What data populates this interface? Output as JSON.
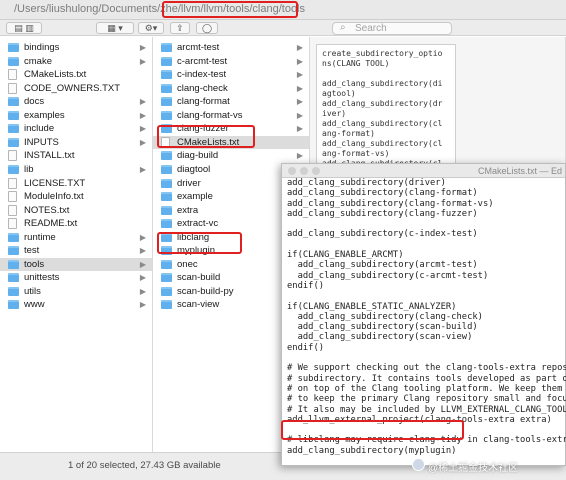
{
  "finder": {
    "path": "/Users/liushulong/Documents/zhe/llvm/llvm/tools/clang/tools",
    "search_placeholder": "Search",
    "status": "1 of 20 selected, 27.43 GB available",
    "column1": [
      {
        "label": "bindings",
        "kind": "folder"
      },
      {
        "label": "cmake",
        "kind": "folder"
      },
      {
        "label": "CMakeLists.txt",
        "kind": "file"
      },
      {
        "label": "CODE_OWNERS.TXT",
        "kind": "file"
      },
      {
        "label": "docs",
        "kind": "folder"
      },
      {
        "label": "examples",
        "kind": "folder"
      },
      {
        "label": "include",
        "kind": "folder"
      },
      {
        "label": "INPUTS",
        "kind": "folder"
      },
      {
        "label": "INSTALL.txt",
        "kind": "file"
      },
      {
        "label": "lib",
        "kind": "folder"
      },
      {
        "label": "LICENSE.TXT",
        "kind": "file"
      },
      {
        "label": "ModuleInfo.txt",
        "kind": "file"
      },
      {
        "label": "NOTES.txt",
        "kind": "file"
      },
      {
        "label": "README.txt",
        "kind": "file"
      },
      {
        "label": "runtime",
        "kind": "folder"
      },
      {
        "label": "test",
        "kind": "folder"
      },
      {
        "label": "tools",
        "kind": "folder",
        "selected": true
      },
      {
        "label": "unittests",
        "kind": "folder"
      },
      {
        "label": "utils",
        "kind": "folder"
      },
      {
        "label": "www",
        "kind": "folder"
      }
    ],
    "column2": [
      {
        "label": "arcmt-test",
        "kind": "folder"
      },
      {
        "label": "c-arcmt-test",
        "kind": "folder"
      },
      {
        "label": "c-index-test",
        "kind": "folder"
      },
      {
        "label": "clang-check",
        "kind": "folder"
      },
      {
        "label": "clang-format",
        "kind": "folder"
      },
      {
        "label": "clang-format-vs",
        "kind": "folder"
      },
      {
        "label": "clang-fuzzer",
        "kind": "folder"
      },
      {
        "label": "CMakeLists.txt",
        "kind": "file",
        "selected": true
      },
      {
        "label": "diag-build",
        "kind": "folder"
      },
      {
        "label": "diagtool",
        "kind": "folder"
      },
      {
        "label": "driver",
        "kind": "folder"
      },
      {
        "label": "example",
        "kind": "folder"
      },
      {
        "label": "extra",
        "kind": "folder"
      },
      {
        "label": "extract-vc",
        "kind": "folder"
      },
      {
        "label": "libclang",
        "kind": "folder"
      },
      {
        "label": "myplugin",
        "kind": "folder"
      },
      {
        "label": "onec",
        "kind": "folder"
      },
      {
        "label": "scan-build",
        "kind": "folder"
      },
      {
        "label": "scan-build-py",
        "kind": "folder"
      },
      {
        "label": "scan-view",
        "kind": "folder"
      }
    ],
    "preview": "create_subdirectory_optio\nns(CLANG TOOL)\n\nadd_clang_subdirectory(di\nagtool)\nadd_clang_subdirectory(dr\niver)\nadd_clang_subdirectory(cl\nang-format)\nadd_clang_subdirectory(cl\nang-format-vs)\nadd_clang_subdirectory(cl"
  },
  "editor": {
    "title": "CMakeLists.txt — Ed",
    "lines": [
      "add_clang_subdirectory(driver)",
      "add_clang_subdirectory(clang-format)",
      "add_clang_subdirectory(clang-format-vs)",
      "add_clang_subdirectory(clang-fuzzer)",
      "",
      "add_clang_subdirectory(c-index-test)",
      "",
      "if(CLANG_ENABLE_ARCMT)",
      "  add_clang_subdirectory(arcmt-test)",
      "  add_clang_subdirectory(c-arcmt-test)",
      "endif()",
      "",
      "if(CLANG_ENABLE_STATIC_ANALYZER)",
      "  add_clang_subdirectory(clang-check)",
      "  add_clang_subdirectory(scan-build)",
      "  add_clang_subdirectory(scan-view)",
      "endif()",
      "",
      "# We support checking out the clang-tools-extra reposi",
      "# subdirectory. It contains tools developed as part of",
      "# on top of the Clang tooling platform. We keep them i",
      "# to keep the primary Clang repository small and focus",
      "# It also may be included by LLVM_EXTERNAL_CLANG_TOOLS",
      "add_llvm_external_project(clang-tools-extra extra)",
      "",
      "# libclang may require clang-tidy in clang-tools-extra",
      "add_clang_subdirectory(myplugin)"
    ]
  },
  "watermark": "@稀土掘金技术社区"
}
